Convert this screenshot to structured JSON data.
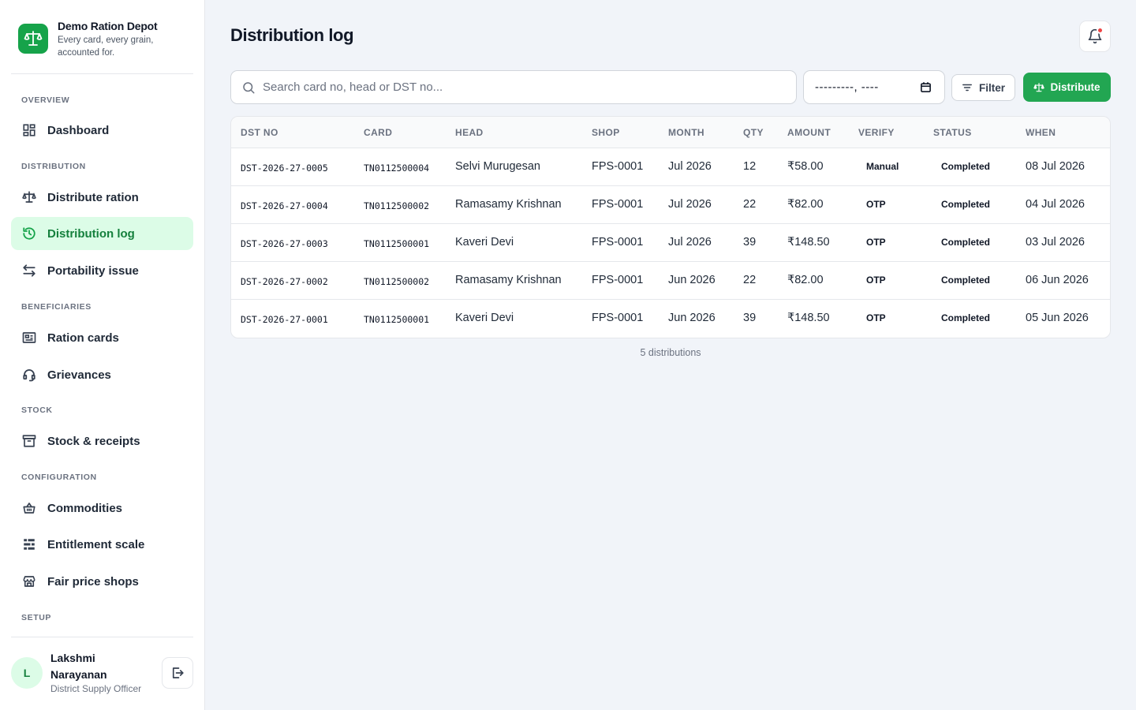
{
  "brand": {
    "name": "Demo Ration Depot",
    "tagline": "Every card, every grain, accounted for."
  },
  "nav": {
    "sections": [
      "OVERVIEW",
      "DISTRIBUTION",
      "BENEFICIARIES",
      "STOCK",
      "CONFIGURATION",
      "SETUP"
    ],
    "items": [
      {
        "label": "Dashboard",
        "icon": "dashboard-icon"
      },
      {
        "label": "Distribute ration",
        "icon": "scale-icon"
      },
      {
        "label": "Distribution log",
        "icon": "history-icon",
        "active": true
      },
      {
        "label": "Portability issue",
        "icon": "swap-arrows-icon"
      },
      {
        "label": "Ration cards",
        "icon": "card-icon"
      },
      {
        "label": "Grievances",
        "icon": "headset-icon"
      },
      {
        "label": "Stock & receipts",
        "icon": "archive-box-icon"
      },
      {
        "label": "Commodities",
        "icon": "basket-icon"
      },
      {
        "label": "Entitlement scale",
        "icon": "scale-list-icon"
      },
      {
        "label": "Fair price shops",
        "icon": "store-icon"
      }
    ]
  },
  "user": {
    "initial": "L",
    "name": "Lakshmi Narayanan",
    "role": "District Supply Officer"
  },
  "page": {
    "title": "Distribution log"
  },
  "toolbar": {
    "search_placeholder": "Search card no, head or DST no...",
    "date_value": "---------, ----",
    "filter_label": "Filter",
    "distribute_label": "Distribute"
  },
  "table": {
    "columns": [
      "DST NO",
      "CARD",
      "HEAD",
      "SHOP",
      "MONTH",
      "QTY",
      "AMOUNT",
      "VERIFY",
      "STATUS",
      "WHEN"
    ],
    "rows": [
      {
        "dst": "DST-2026-27-0005",
        "card": "TN0112500004",
        "head": "Selvi Murugesan",
        "shop": "FPS-0001",
        "month": "Jul 2026",
        "qty": "12",
        "amount": "₹58.00",
        "verify": "Manual",
        "status": "Completed",
        "when": "08 Jul 2026"
      },
      {
        "dst": "DST-2026-27-0004",
        "card": "TN0112500002",
        "head": "Ramasamy Krishnan",
        "shop": "FPS-0001",
        "month": "Jul 2026",
        "qty": "22",
        "amount": "₹82.00",
        "verify": "OTP",
        "status": "Completed",
        "when": "04 Jul 2026"
      },
      {
        "dst": "DST-2026-27-0003",
        "card": "TN0112500001",
        "head": "Kaveri Devi",
        "shop": "FPS-0001",
        "month": "Jul 2026",
        "qty": "39",
        "amount": "₹148.50",
        "verify": "OTP",
        "status": "Completed",
        "when": "03 Jul 2026"
      },
      {
        "dst": "DST-2026-27-0002",
        "card": "TN0112500002",
        "head": "Ramasamy Krishnan",
        "shop": "FPS-0001",
        "month": "Jun 2026",
        "qty": "22",
        "amount": "₹82.00",
        "verify": "OTP",
        "status": "Completed",
        "when": "06 Jun 2026"
      },
      {
        "dst": "DST-2026-27-0001",
        "card": "TN0112500001",
        "head": "Kaveri Devi",
        "shop": "FPS-0001",
        "month": "Jun 2026",
        "qty": "39",
        "amount": "₹148.50",
        "verify": "OTP",
        "status": "Completed",
        "when": "05 Jun 2026"
      }
    ],
    "footer": "5 distributions"
  },
  "colors": {
    "accent": "#22a652",
    "active_bg": "#dcfce7",
    "notification_dot": "#ef4444"
  }
}
